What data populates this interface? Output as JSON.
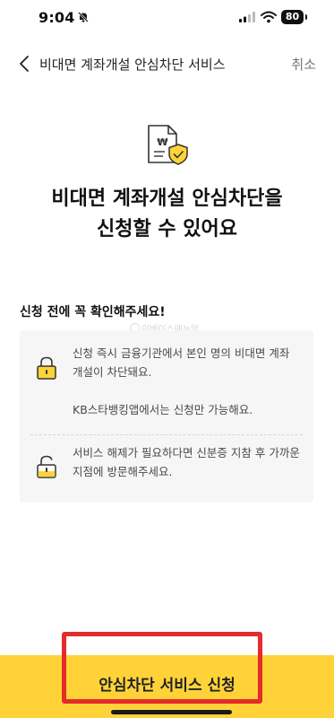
{
  "status_bar": {
    "time": "9:04",
    "battery": "80"
  },
  "header": {
    "title": "비대면 계좌개설 안심차단 서비스",
    "cancel_label": "취소"
  },
  "headline": {
    "line1": "비대면 계좌개설 안심차단을",
    "line2": "신청할 수 있어요"
  },
  "notice": {
    "title": "신청 전에 꼭 확인해주세요!",
    "items": [
      {
        "icon": "lock-closed-icon",
        "text": "신청 즉시 금융기관에서 본인 명의 비대면 계좌 개설이 차단돼요.",
        "subtext": "KB스타뱅킹앱에서는 신청만 가능해요."
      },
      {
        "icon": "lock-open-icon",
        "text": "서비스 해제가 필요하다면 신분증 지참 후 가까운 지점에 방문해주세요."
      }
    ]
  },
  "watermark": "이베이스매뉴얼",
  "cta": {
    "label": "안심차단 서비스 신청"
  },
  "colors": {
    "accent_yellow": "#ffd338",
    "highlight_red": "#e52b2b"
  }
}
